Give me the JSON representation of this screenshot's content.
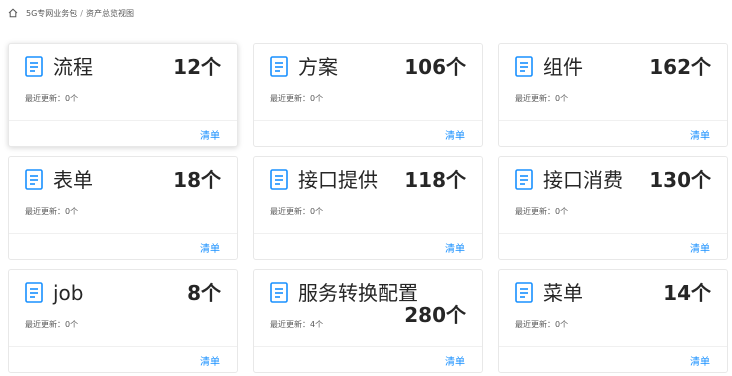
{
  "breadcrumb": {
    "items": [
      "5G专网业务包",
      "资产总览视图"
    ],
    "separator": "/"
  },
  "colors": {
    "accent": "#1890ff",
    "icon": "#1890ff"
  },
  "icons": {
    "home": "home-icon",
    "doc": "document-list-icon"
  },
  "cards": [
    {
      "title": "流程",
      "count": "12个",
      "recent_label": "最近更新：",
      "recent_value": "0个",
      "link": "清单"
    },
    {
      "title": "方案",
      "count": "106个",
      "recent_label": "最近更新：",
      "recent_value": "0个",
      "link": "清单"
    },
    {
      "title": "组件",
      "count": "162个",
      "recent_label": "最近更新：",
      "recent_value": "0个",
      "link": "清单"
    },
    {
      "title": "表单",
      "count": "18个",
      "recent_label": "最近更新：",
      "recent_value": "0个",
      "link": "清单"
    },
    {
      "title": "接口提供",
      "count": "118个",
      "recent_label": "最近更新：",
      "recent_value": "0个",
      "link": "清单"
    },
    {
      "title": "接口消费",
      "count": "130个",
      "recent_label": "最近更新：",
      "recent_value": "0个",
      "link": "清单"
    },
    {
      "title": "job",
      "count": "8个",
      "recent_label": "最近更新：",
      "recent_value": "0个",
      "link": "清单"
    },
    {
      "title": "服务转换配置",
      "count": "280个",
      "recent_label": "最近更新：",
      "recent_value": "4个",
      "link": "清单"
    },
    {
      "title": "菜单",
      "count": "14个",
      "recent_label": "最近更新：",
      "recent_value": "0个",
      "link": "清单"
    }
  ]
}
